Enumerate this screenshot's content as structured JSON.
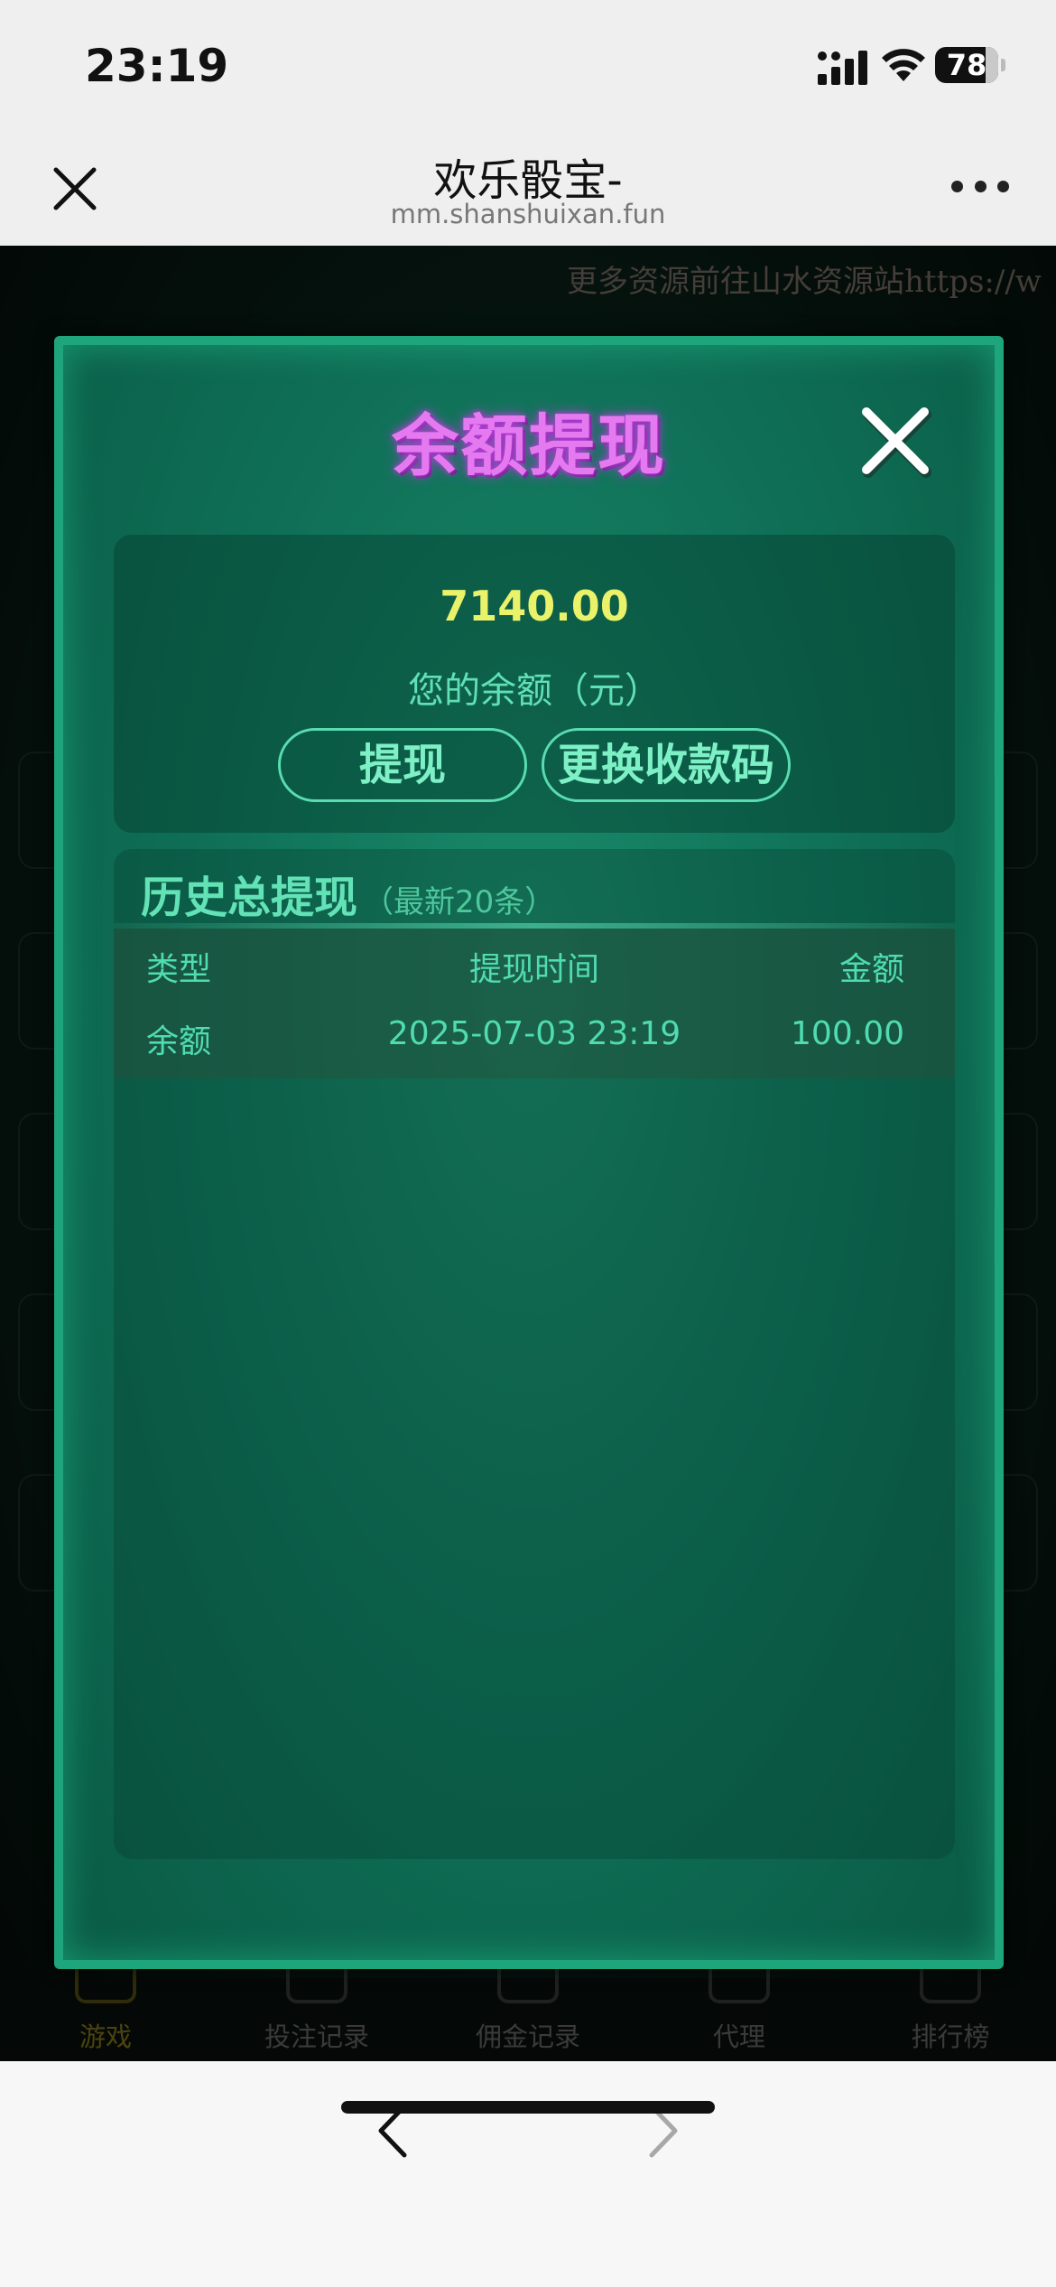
{
  "status_bar": {
    "time": "23:19",
    "battery": "78"
  },
  "browser": {
    "title": "欢乐骰宝-",
    "url": "mm.shanshuixan.fun"
  },
  "page": {
    "marquee": "更多资源前往山水资源站https://w",
    "tabs": [
      {
        "label": "游戏",
        "icon": "gamepad-icon",
        "active": true
      },
      {
        "label": "投注记录",
        "icon": "notepad-icon",
        "active": false
      },
      {
        "label": "佣金记录",
        "icon": "money-bag-icon",
        "active": false
      },
      {
        "label": "代理",
        "icon": "piggy-bank-icon",
        "active": false
      },
      {
        "label": "排行榜",
        "icon": "trophy-icon",
        "active": false
      }
    ]
  },
  "modal": {
    "title": "余额提现",
    "balance_amount": "7140.00",
    "balance_label": "您的余额（元）",
    "withdraw_button": "提现",
    "change_code_button": "更换收款码",
    "history_title": "历史总提现",
    "history_subtitle": "（最新20条）",
    "table": {
      "headers": {
        "type": "类型",
        "time": "提现时间",
        "amount": "金额"
      },
      "rows": [
        {
          "type": "余额",
          "time": "2025-07-03 23:19",
          "amount": "100.00"
        }
      ]
    }
  },
  "colors": {
    "modal_title": "#e57af0",
    "balance_amount": "#eaf26a",
    "accent_green": "#4fdcb0",
    "modal_border": "#1fa57c"
  }
}
